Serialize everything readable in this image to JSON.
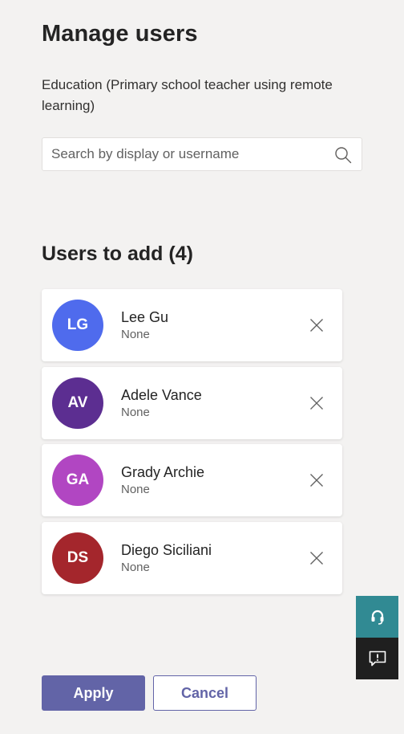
{
  "page": {
    "title": "Manage users",
    "subtitle": "Education (Primary school teacher using remote learning)"
  },
  "search": {
    "placeholder": "Search by display or username",
    "value": "",
    "icon": "search-icon"
  },
  "users_section": {
    "heading": "Users to add (4)",
    "users": [
      {
        "initials": "LG",
        "name": "Lee Gu",
        "role": "None",
        "avatar_color": "#4f6bed"
      },
      {
        "initials": "AV",
        "name": "Adele Vance",
        "role": "None",
        "avatar_color": "#5c2e91"
      },
      {
        "initials": "GA",
        "name": "Grady Archie",
        "role": "None",
        "avatar_color": "#b146c2"
      },
      {
        "initials": "DS",
        "name": "Diego Siciliani",
        "role": "None",
        "avatar_color": "#a4262c"
      }
    ]
  },
  "side_tabs": {
    "support_icon": "headset-icon",
    "support_color": "#318a93",
    "feedback_icon": "feedback-icon",
    "feedback_color": "#1f1f1f"
  },
  "actions": {
    "apply_label": "Apply",
    "cancel_label": "Cancel",
    "accent_color": "#6264a7"
  }
}
